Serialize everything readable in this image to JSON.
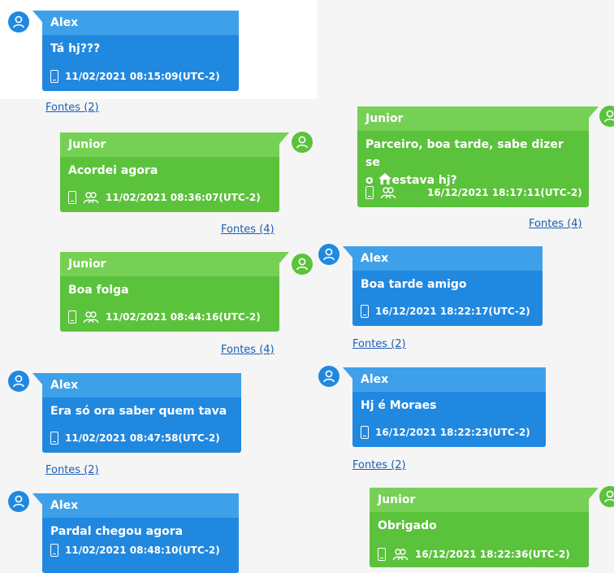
{
  "messages": [
    {
      "side": "left",
      "sender": "Alex",
      "text": "Tá hj???",
      "timestamp": "11/02/2021 08:15:09(UTC-2)",
      "fontes": "Fontes (2)",
      "group": false
    },
    {
      "side": "right",
      "sender": "Junior",
      "text": "Acordei agora",
      "timestamp": "11/02/2021 08:36:07(UTC-2)",
      "fontes": "Fontes (4)",
      "group": true
    },
    {
      "side": "right",
      "sender": "Junior",
      "text": "Boa folga",
      "timestamp": "11/02/2021 08:44:16(UTC-2)",
      "fontes": "Fontes (4)",
      "group": true
    },
    {
      "side": "left",
      "sender": "Alex",
      "text": "Era só ora saber quem tava",
      "timestamp": "11/02/2021 08:47:58(UTC-2)",
      "fontes": "Fontes (2)",
      "group": false
    },
    {
      "side": "left",
      "sender": "Alex",
      "text": "Pardal chegou agora",
      "timestamp": "11/02/2021 08:48:10(UTC-2)",
      "fontes": "",
      "group": false
    },
    {
      "side": "right",
      "sender": "Junior",
      "text_line1": "Parceiro, boa tarde, sabe dizer se",
      "text_line2_before": "o ",
      "text_line2_after": "estava hj?",
      "timestamp": "16/12/2021 18:17:11(UTC-2)",
      "fontes": "Fontes (4)",
      "group": true
    },
    {
      "side": "left",
      "sender": "Alex",
      "text": "Boa tarde amigo",
      "timestamp": "16/12/2021 18:22:17(UTC-2)",
      "fontes": "Fontes (2)",
      "group": false
    },
    {
      "side": "left",
      "sender": "Alex",
      "text": "Hj é Moraes",
      "timestamp": "16/12/2021 18:22:23(UTC-2)",
      "fontes": "Fontes (2)",
      "group": false
    },
    {
      "side": "right",
      "sender": "Junior",
      "text": "Obrigado",
      "timestamp": "16/12/2021 18:22:36(UTC-2)",
      "fontes": "",
      "group": true
    }
  ],
  "colors": {
    "blue": "#2188e0",
    "blue_header": "#3fa0ea",
    "green": "#5bc23c",
    "green_header": "#76d056",
    "link": "#1a5fb4"
  },
  "icons": {
    "avatar": "person-icon",
    "device": "phone-icon",
    "group": "group-icon",
    "emoji": "house-icon"
  }
}
